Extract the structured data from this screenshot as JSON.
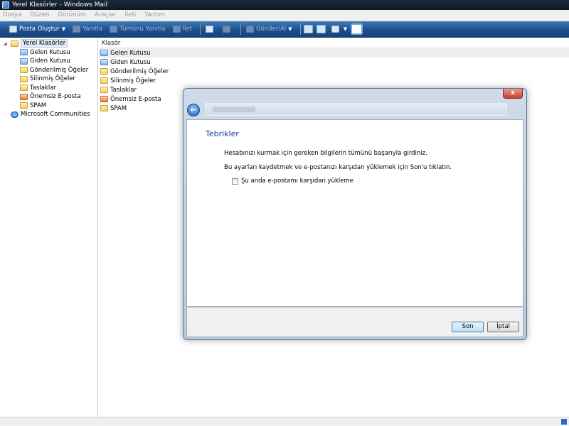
{
  "window": {
    "title": "Yerel Klasörler - Windows Mail"
  },
  "menu": [
    "Dosya",
    "Düzen",
    "Görünüm",
    "Araçlar",
    "İleti",
    "Yardım"
  ],
  "toolbar": {
    "compose": "Posta Oluştur",
    "reply": "Yanıtla",
    "reply_all": "Tümünü Yanıtla",
    "forward": "İlet",
    "send_receive": "Gönder/Al"
  },
  "tree": {
    "root": "Yerel Klasörler",
    "items": [
      "Gelen Kutusu",
      "Giden Kutusu",
      "Gönderilmiş Öğeler",
      "Silinmiş Öğeler",
      "Taslaklar",
      "Önemsiz E-posta",
      "SPAM"
    ],
    "community": "Microsoft Communities"
  },
  "list": {
    "header": "Klasör",
    "rows": [
      "Gelen Kutusu",
      "Giden Kutusu",
      "Gönderilmiş Öğeler",
      "Silinmiş Öğeler",
      "Taslaklar",
      "Önemsiz E-posta",
      "SPAM"
    ]
  },
  "dialog": {
    "close": "x",
    "heading": "Tebrikler",
    "text1": "Hesabınızı kurmak için gereken bilgilerin tümünü başarıyla girdiniz.",
    "text2": "Bu ayarları kaydetmek ve e-postanızı karşıdan yüklemek için Son'u tıklatın.",
    "checkbox": "Şu anda e-postamı karşıdan yükleme",
    "finish": "Son",
    "cancel": "İptal"
  }
}
